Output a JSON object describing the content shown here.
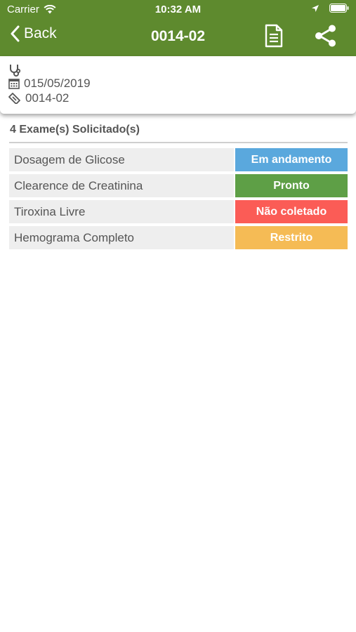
{
  "status_bar": {
    "carrier": "Carrier",
    "time": "10:32 AM"
  },
  "nav": {
    "back_label": "Back",
    "title": "0014-02",
    "doc_icon": "document-icon",
    "share_icon": "share-icon"
  },
  "info": {
    "date": "015/05/2019",
    "code": "0014-02"
  },
  "section": {
    "title": "4 Exame(s) Solicitado(s)"
  },
  "exams": [
    {
      "name": "Dosagem de Glicose",
      "status": "Em andamento",
      "color": "#5aa8dd"
    },
    {
      "name": "Clearence de Creatinina",
      "status": "Pronto",
      "color": "#5e9f46"
    },
    {
      "name": "Tiroxina Livre",
      "status": "Não coletado",
      "color": "#fb5c56"
    },
    {
      "name": "Hemograma Completo",
      "status": "Restrito",
      "color": "#f5bb55"
    }
  ],
  "colors": {
    "header": "#5e8a2e",
    "text_gray": "#555555",
    "row_bg": "#eeeeee"
  }
}
